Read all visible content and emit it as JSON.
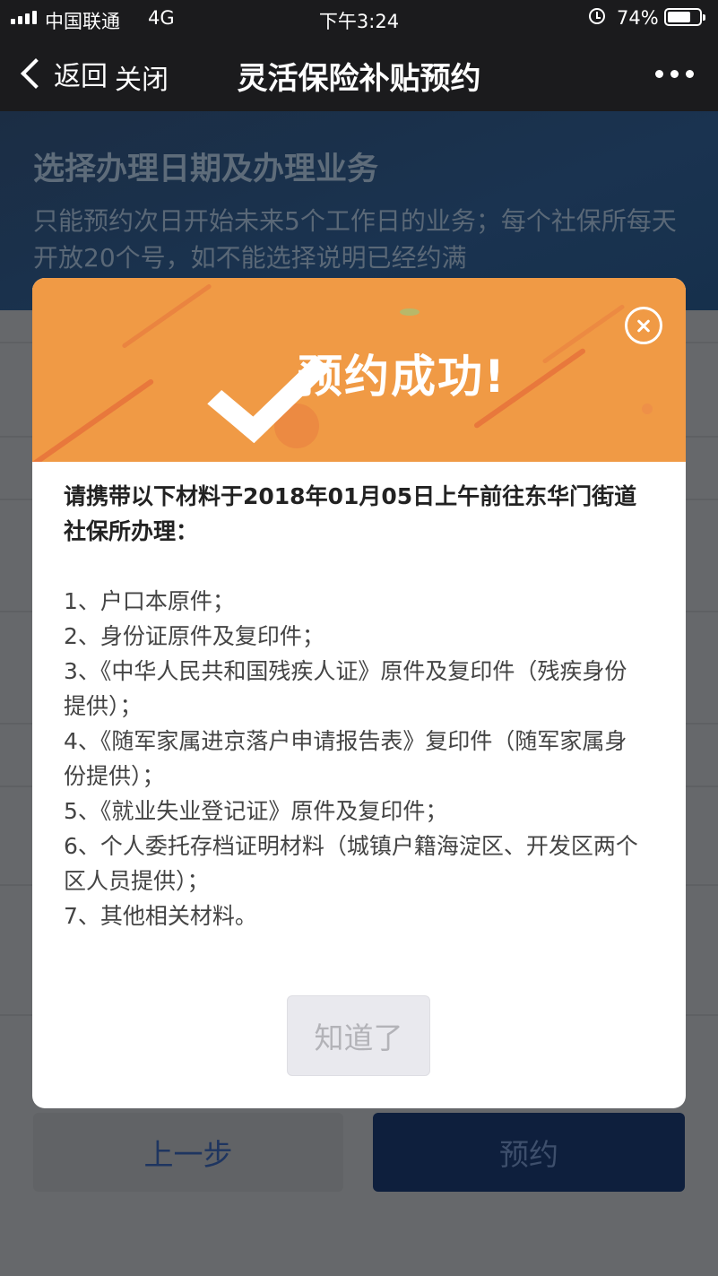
{
  "status_bar": {
    "carrier": "中国联通",
    "network": "4G",
    "time": "下午3:24",
    "battery_percent": "74%",
    "battery_level": 0.74
  },
  "nav": {
    "back_label": "返回",
    "close_label": "关闭",
    "title": "灵活保险补贴预约",
    "more_icon": "more-dots-icon"
  },
  "banner": {
    "title": "选择办理日期及办理业务",
    "description": "只能预约次日开始未来5个工作日的业务；每个社保所每天开放20个号，如不能选择说明已经约满"
  },
  "footer_buttons": {
    "prev_label": "上一步",
    "book_label": "预约"
  },
  "modal": {
    "title": "预约成功!",
    "intro": "请携带以下材料于2018年01月05日上午前往东华门街道社保所办理：",
    "items": [
      "1、户口本原件；",
      "2、身份证原件及复印件；",
      "3、《中华人民共和国残疾人证》原件及复印件（残疾身份提供）；",
      "4、《随军家属进京落户申请报告表》复印件（随军家属身份提供）；",
      "5、《就业失业登记证》原件及复印件；",
      "6、个人委托存档证明材料（城镇户籍海淀区、开发区两个区人员提供）；",
      "7、其他相关材料。"
    ],
    "confirm_label": "知道了"
  },
  "colors": {
    "modal_header": "#f09a45",
    "navbar": "#1b1b1d",
    "book_button": "#0e1f3d"
  }
}
